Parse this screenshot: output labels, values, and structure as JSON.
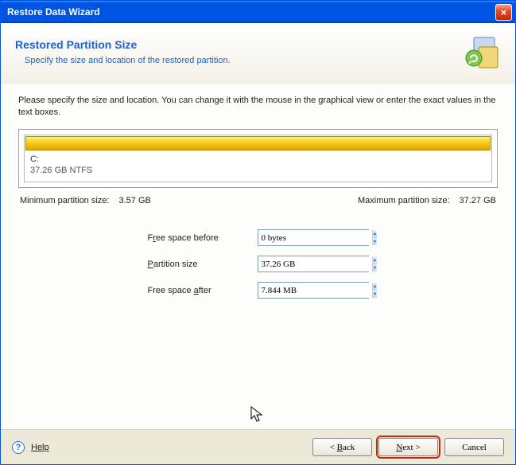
{
  "titlebar": {
    "title": "Restore Data Wizard"
  },
  "header": {
    "title": "Restored Partition Size",
    "subtitle": "Specify the size and location of the restored partition."
  },
  "body": {
    "instruction": "Please specify the size and location. You can change it with the mouse in the graphical view or enter the exact values in the text boxes.",
    "partition": {
      "drive": "C:",
      "info": "37.26 GB  NTFS"
    },
    "min_label": "Minimum partition size:",
    "min_value": "3.57 GB",
    "max_label": "Maximum partition size:",
    "max_value": "37.27 GB",
    "fields": {
      "free_before": {
        "label_pre": "F",
        "label_u": "r",
        "label_post": "ee space before",
        "value": "0 bytes"
      },
      "part_size": {
        "label_pre": "",
        "label_u": "P",
        "label_post": "artition size",
        "value": "37.26 GB"
      },
      "free_after": {
        "label_pre": "Free space ",
        "label_u": "a",
        "label_post": "fter",
        "value": "7.844 MB"
      }
    }
  },
  "footer": {
    "help": "Help",
    "back_pre": "< ",
    "back_u": "B",
    "back_post": "ack",
    "next_pre": "",
    "next_u": "N",
    "next_post": "ext >",
    "cancel": "Cancel"
  }
}
